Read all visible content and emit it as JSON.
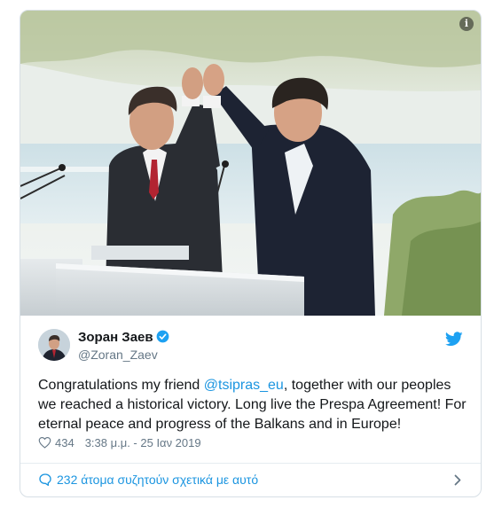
{
  "tweet": {
    "author_name": "Зоран Заев",
    "author_handle": "@Zoran_Zaev",
    "text_before": "Congratulations my friend ",
    "mention": "@tsipras_eu",
    "text_after": ", together with our peoples we reached a historical victory. Long live the Prespa Agreement! For eternal peace and progress of the Balkans and in Europe!",
    "likes": "434",
    "timestamp": "3:38 μ.μ. - 25 Ιαν 2019",
    "conversation": "232 άτομα συζητούν σχετικά με αυτό"
  },
  "icons": {
    "info": "info-icon",
    "verified": "verified-badge-icon",
    "brand": "twitter-bird-icon",
    "like": "heart-icon",
    "reply": "speech-bubble-icon",
    "chevron": "chevron-right-icon"
  },
  "info_glyph": "i",
  "colors": {
    "accent": "#1b95e0",
    "text": "#14171a",
    "muted": "#657786",
    "border": "#d7dfe5",
    "suit_dark": "#1d2333",
    "tie_red": "#b22431"
  }
}
